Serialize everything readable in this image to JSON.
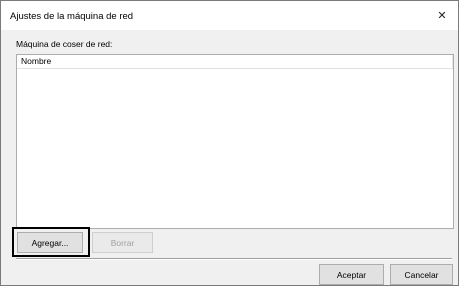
{
  "dialog": {
    "title": "Ajustes de la máquina de red",
    "close_glyph": "✕"
  },
  "section_label": "Máquina de coser de red:",
  "list": {
    "columns": [
      "Nombre"
    ],
    "rows": []
  },
  "buttons": {
    "add": "Agregar...",
    "delete": "Borrar",
    "ok": "Aceptar",
    "cancel": "Cancelar"
  },
  "icons": {
    "close": "close-icon"
  },
  "colors": {
    "dialog_bg": "#f0f0f0",
    "highlight_border": "#000000"
  }
}
